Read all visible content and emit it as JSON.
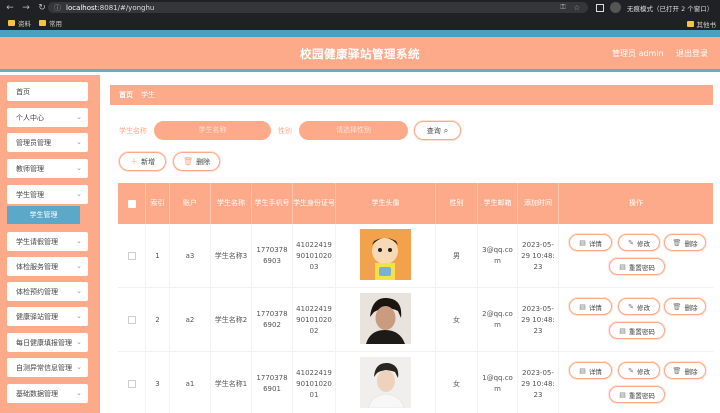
{
  "browser": {
    "url_host": "localhost",
    "url_rest": ":8081/#/yonghu",
    "incognito_text": "无痕模式（已打开 2 个窗口）",
    "bookmarks": [
      "资料",
      "常用"
    ],
    "other_bookmarks": "其他书"
  },
  "header": {
    "title": "校园健康驿站管理系统",
    "user": "管理员 admin",
    "logout": "退出登录"
  },
  "sidebar": {
    "items": [
      {
        "label": "首页",
        "chevron": false
      },
      {
        "label": "个人中心",
        "chevron": true
      },
      {
        "label": "管理员管理",
        "chevron": true
      },
      {
        "label": "教师管理",
        "chevron": true
      },
      {
        "label": "学生管理",
        "chevron": true
      },
      {
        "label": "学生请假管理",
        "chevron": true
      },
      {
        "label": "体检服务管理",
        "chevron": true
      },
      {
        "label": "体检预约管理",
        "chevron": true
      },
      {
        "label": "健康驿站管理",
        "chevron": true
      },
      {
        "label": "每日健康填报管理",
        "chevron": true
      },
      {
        "label": "自测异常信息管理",
        "chevron": true
      },
      {
        "label": "基础数据管理",
        "chevron": true
      }
    ],
    "active_sub": "学生管理"
  },
  "breadcrumb": {
    "home": "首页",
    "current": "学生"
  },
  "search": {
    "name_label": "学生名称",
    "name_placeholder": "学生名称",
    "gender_label": "性别",
    "gender_placeholder": "请选择性别",
    "query_button": "查询"
  },
  "toolbar": {
    "add": "新增",
    "delete": "删除"
  },
  "table": {
    "headers": [
      "索引",
      "账户",
      "学生名称",
      "学生手机号",
      "学生身份证号",
      "学生头像",
      "性别",
      "学生邮箱",
      "添加时间",
      "操作"
    ],
    "rows": [
      {
        "index": "1",
        "account": "a3",
        "name": "学生名称3",
        "phone": "17703786903",
        "idcard": "410224199010102003",
        "avatar": "cartoon",
        "gender": "男",
        "email": "3@qq.com",
        "time": "2023-05-29 10:48:23"
      },
      {
        "index": "2",
        "account": "a2",
        "name": "学生名称2",
        "phone": "17703786902",
        "idcard": "410224199010102002",
        "avatar": "photo-dark",
        "gender": "女",
        "email": "2@qq.com",
        "time": "2023-05-29 10:48:23"
      },
      {
        "index": "3",
        "account": "a1",
        "name": "学生名称1",
        "phone": "17703786901",
        "idcard": "410224199010102001",
        "avatar": "photo-light",
        "gender": "女",
        "email": "1@qq.com",
        "time": "2023-05-29 10:48:23"
      }
    ],
    "actions": {
      "detail": "详情",
      "edit": "修改",
      "delete": "删除",
      "reset": "重置密码"
    }
  },
  "colors": {
    "accent": "#fdaa8a",
    "blue": "#5ba8c9"
  }
}
